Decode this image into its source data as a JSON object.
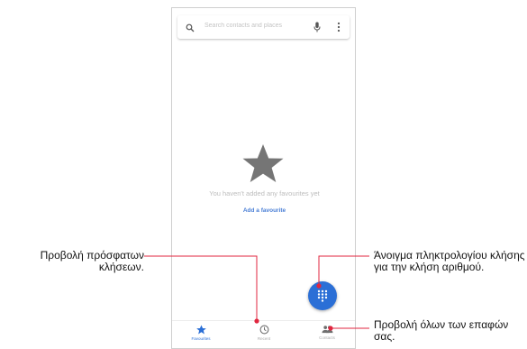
{
  "search": {
    "placeholder": "Search contacts and places",
    "search_icon": "search-icon",
    "mic_icon": "mic-icon",
    "more_icon": "more-vert-icon"
  },
  "favourites": {
    "empty_icon": "star-icon",
    "empty_message": "You haven't added any favourites yet",
    "add_link": "Add a favourite"
  },
  "fab": {
    "icon": "dialpad-icon"
  },
  "nav": {
    "items": [
      {
        "label": "Favourites",
        "icon": "star-icon",
        "active": true
      },
      {
        "label": "Recent",
        "icon": "clock-icon",
        "active": false
      },
      {
        "label": "Contacts",
        "icon": "people-icon",
        "active": false
      }
    ]
  },
  "callouts": {
    "recent": "Προβολή πρόσφατων κλήσεων.",
    "dialpad": "Άνοιγμα πληκτρολογίου κλήσης για την κλήση αριθμού.",
    "contacts": "Προβολή όλων των επαφών σας."
  },
  "colors": {
    "accent": "#2b6fd6",
    "inactive": "#a9a9a9",
    "empty_star": "#757575",
    "callout_line": "#e0263f"
  }
}
